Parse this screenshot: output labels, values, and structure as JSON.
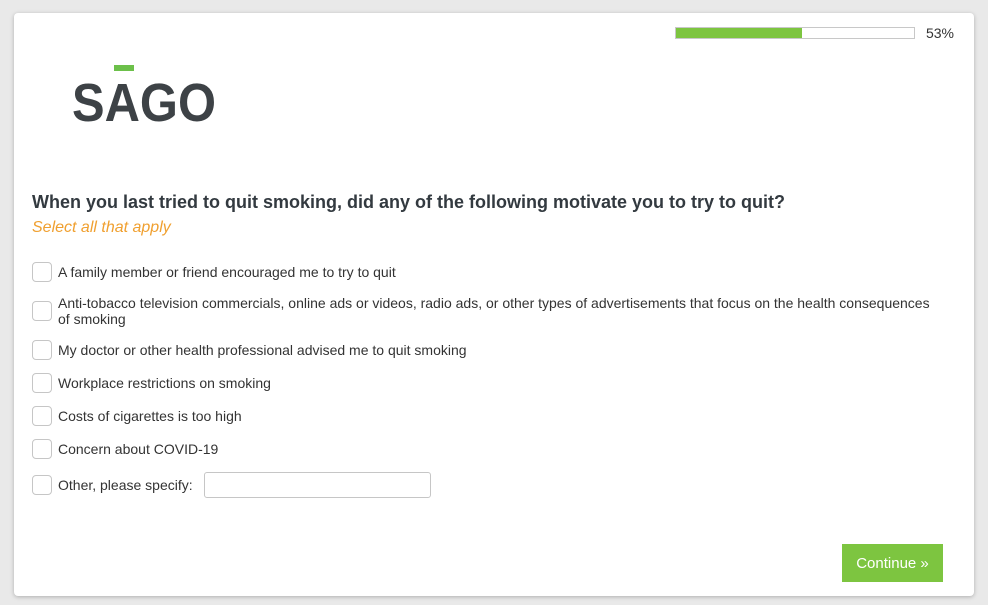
{
  "progress": {
    "value": 53,
    "label": "53%"
  },
  "logo": {
    "text": "SAGO",
    "brand_color": "#3d4246",
    "accent_color": "#6cc04a"
  },
  "question": {
    "title": "When you last tried to quit smoking, did any of the following motivate you to try to quit?",
    "instruction": "Select all that apply"
  },
  "options": [
    {
      "label": "A family member or friend encouraged me to try to quit"
    },
    {
      "label": "Anti-tobacco television commercials, online ads or videos, radio ads, or other types of advertisements that focus on the health consequences of smoking"
    },
    {
      "label": "My doctor or other health professional advised me to quit smoking"
    },
    {
      "label": "Workplace restrictions on smoking"
    },
    {
      "label": "Costs of cigarettes is too high"
    },
    {
      "label": "Concern about COVID-19"
    },
    {
      "label": "Other, please specify:"
    }
  ],
  "other_input": {
    "value": "",
    "placeholder": ""
  },
  "continue_button": {
    "label": "Continue »"
  },
  "colors": {
    "accent_green": "#7dc540",
    "instruction_orange": "#f0a030"
  }
}
